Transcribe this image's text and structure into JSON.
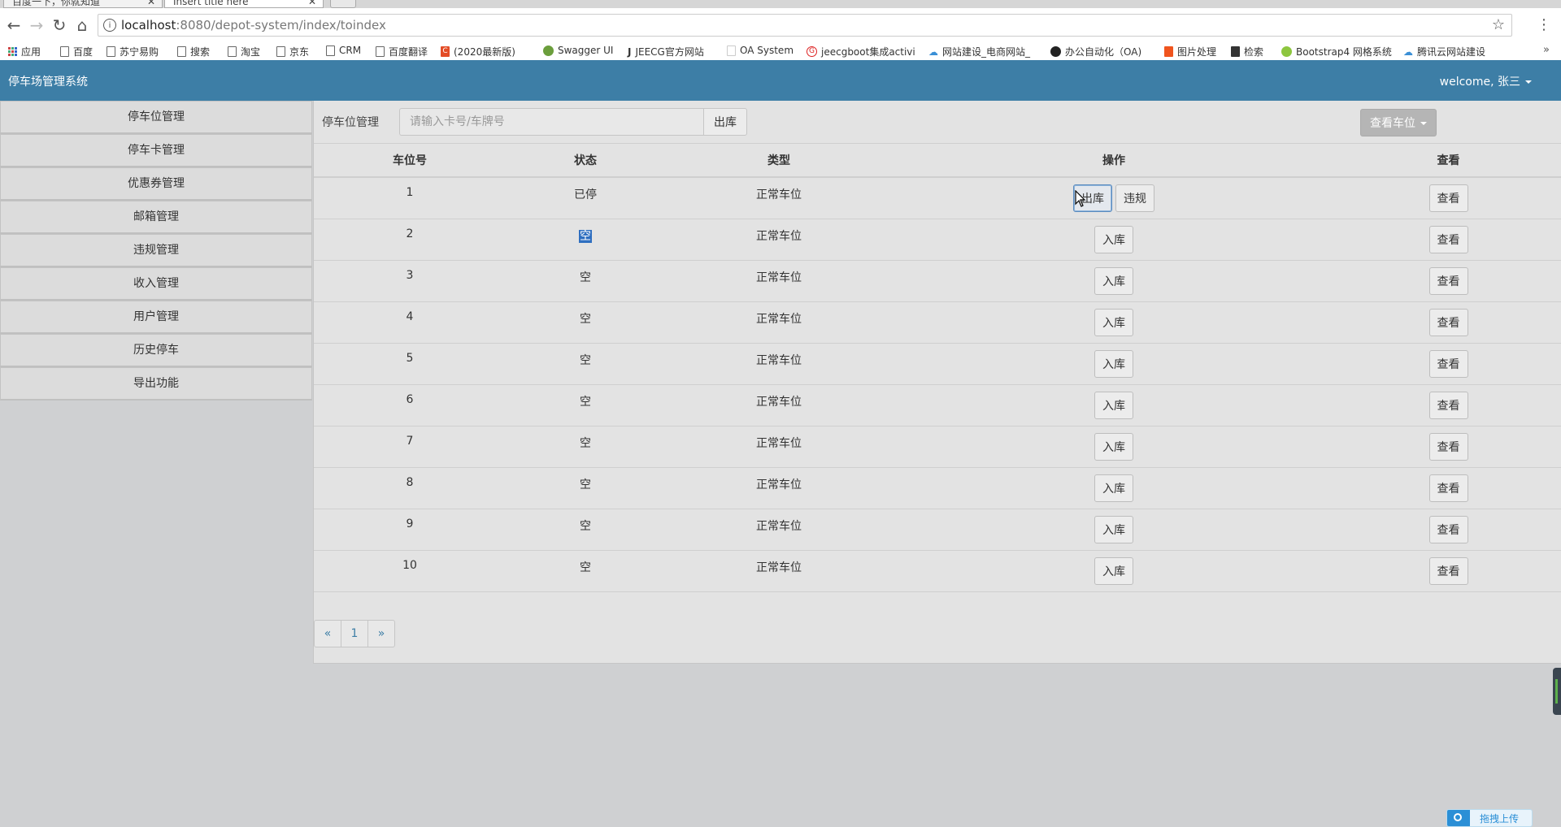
{
  "browser": {
    "tabs": [
      {
        "label": "百度一下，你就知道"
      },
      {
        "label": "Insert title here"
      }
    ],
    "url_host": "localhost",
    "url_rest": ":8080/depot-system/index/toindex",
    "bookmarks": [
      {
        "label": "应用"
      },
      {
        "label": "百度"
      },
      {
        "label": "苏宁易购"
      },
      {
        "label": "搜索"
      },
      {
        "label": "淘宝"
      },
      {
        "label": "京东"
      },
      {
        "label": "CRM"
      },
      {
        "label": "百度翻译"
      },
      {
        "label": "(2020最新版)"
      },
      {
        "label": "Swagger UI"
      },
      {
        "label": "JEECG官方网站"
      },
      {
        "label": "OA System"
      },
      {
        "label": "jeecgboot集成activi"
      },
      {
        "label": "网站建设_电商网站_"
      },
      {
        "label": "办公自动化（OA)"
      },
      {
        "label": "图片处理"
      },
      {
        "label": "检索"
      },
      {
        "label": "Bootstrap4 网格系统"
      },
      {
        "label": "腾讯云网站建设"
      }
    ],
    "more": "»"
  },
  "header": {
    "title": "停车场管理系统",
    "welcome": "welcome, 张三"
  },
  "sidebar": {
    "items": [
      {
        "label": "停车位管理"
      },
      {
        "label": "停车卡管理"
      },
      {
        "label": "优惠券管理"
      },
      {
        "label": "邮箱管理"
      },
      {
        "label": "违规管理"
      },
      {
        "label": "收入管理"
      },
      {
        "label": "用户管理"
      },
      {
        "label": "历史停车"
      },
      {
        "label": "导出功能"
      }
    ]
  },
  "main": {
    "label": "停车位管理",
    "search_placeholder": "请输入卡号/车牌号",
    "search_button": "出库",
    "view_button": "查看车位",
    "columns": [
      "车位号",
      "状态",
      "类型",
      "操作",
      "查看"
    ],
    "rows": [
      {
        "no": "1",
        "status": "已停",
        "type": "正常车位",
        "actions": [
          "出库",
          "违规"
        ],
        "view": "查看"
      },
      {
        "no": "2",
        "status": "空",
        "type": "正常车位",
        "actions": [
          "入库"
        ],
        "view": "查看"
      },
      {
        "no": "3",
        "status": "空",
        "type": "正常车位",
        "actions": [
          "入库"
        ],
        "view": "查看"
      },
      {
        "no": "4",
        "status": "空",
        "type": "正常车位",
        "actions": [
          "入库"
        ],
        "view": "查看"
      },
      {
        "no": "5",
        "status": "空",
        "type": "正常车位",
        "actions": [
          "入库"
        ],
        "view": "查看"
      },
      {
        "no": "6",
        "status": "空",
        "type": "正常车位",
        "actions": [
          "入库"
        ],
        "view": "查看"
      },
      {
        "no": "7",
        "status": "空",
        "type": "正常车位",
        "actions": [
          "入库"
        ],
        "view": "查看"
      },
      {
        "no": "8",
        "status": "空",
        "type": "正常车位",
        "actions": [
          "入库"
        ],
        "view": "查看"
      },
      {
        "no": "9",
        "status": "空",
        "type": "正常车位",
        "actions": [
          "入库"
        ],
        "view": "查看"
      },
      {
        "no": "10",
        "status": "空",
        "type": "正常车位",
        "actions": [
          "入库"
        ],
        "view": "查看"
      }
    ],
    "pager": {
      "prev": "«",
      "current": "1",
      "next": "»"
    }
  },
  "widgets": {
    "upload_label": "拖拽上传"
  },
  "colors": {
    "header_bg": "#3d7ea6",
    "link": "#3d7ea6",
    "selection": "#2f6fc0"
  }
}
